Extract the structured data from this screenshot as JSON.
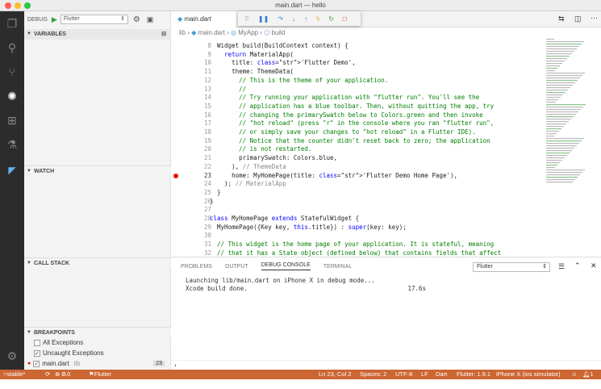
{
  "window": {
    "title": "main.dart — hello"
  },
  "debug": {
    "label": "DEBUG",
    "config": "Flutter"
  },
  "sections": {
    "variables": "VARIABLES",
    "watch": "WATCH",
    "callstack": "CALL STACK",
    "breakpoints": "BREAKPOINTS"
  },
  "breakpoints": [
    {
      "label": "All Exceptions",
      "checked": false
    },
    {
      "label": "Uncaught Exceptions",
      "checked": true
    },
    {
      "label": "main.dart",
      "dir": "lib",
      "line": "23",
      "checked": true
    }
  ],
  "tab": {
    "file": "main.dart"
  },
  "breadcrumb": {
    "dir": "lib",
    "file": "main.dart",
    "cls": "MyApp",
    "method": "build"
  },
  "lines": [
    {
      "n": "8",
      "t": "  Widget build(BuildContext context) {"
    },
    {
      "n": "9",
      "t": "    return MaterialApp("
    },
    {
      "n": "10",
      "t": "      title: 'Flutter Demo',"
    },
    {
      "n": "11",
      "t": "      theme: ThemeData("
    },
    {
      "n": "12",
      "t": "        // This is the theme of your application."
    },
    {
      "n": "13",
      "t": "        //"
    },
    {
      "n": "14",
      "t": "        // Try running your application with \"flutter run\". You'll see the"
    },
    {
      "n": "15",
      "t": "        // application has a blue toolbar. Then, without quitting the app, try"
    },
    {
      "n": "16",
      "t": "        // changing the primarySwatch below to Colors.green and then invoke"
    },
    {
      "n": "17",
      "t": "        // \"hot reload\" (press \"r\" in the console where you ran \"flutter run\","
    },
    {
      "n": "18",
      "t": "        // or simply save your changes to \"hot reload\" in a Flutter IDE)."
    },
    {
      "n": "19",
      "t": "        // Notice that the counter didn't reset back to zero; the application"
    },
    {
      "n": "20",
      "t": "        // is not restarted."
    },
    {
      "n": "21",
      "t": "        primarySwatch: Colors.blue,"
    },
    {
      "n": "22",
      "t": "      ), // ThemeData"
    },
    {
      "n": "23",
      "t": "      home: MyHomePage(title: 'Flutter Demo Home Page'),"
    },
    {
      "n": "24",
      "t": "    ); // MaterialApp"
    },
    {
      "n": "25",
      "t": "  }"
    },
    {
      "n": "26",
      "t": "}"
    },
    {
      "n": "27",
      "t": ""
    },
    {
      "n": "28",
      "t": "class MyHomePage extends StatefulWidget {"
    },
    {
      "n": "29",
      "t": "  MyHomePage({Key key, this.title}) : super(key: key);"
    },
    {
      "n": "30",
      "t": ""
    },
    {
      "n": "31",
      "t": "  // This widget is the home page of your application. It is stateful, meaning"
    },
    {
      "n": "32",
      "t": "  // that it has a State object (defined below) that contains fields that affect"
    }
  ],
  "panel": {
    "tabs": [
      "PROBLEMS",
      "OUTPUT",
      "DEBUG CONSOLE",
      "TERMINAL"
    ],
    "active": "DEBUG CONSOLE",
    "select": "Flutter",
    "output": [
      "Launching lib/main.dart on iPhone X in debug mode...",
      "Xcode build done.                                            17.6s"
    ]
  },
  "status": {
    "branch": "stable*",
    "errors": "0",
    "warnings": "0",
    "run": "Flutter (hello)",
    "pos": "Ln 23, Col 2",
    "spaces": "Spaces: 2",
    "enc": "UTF-8",
    "eol": "LF",
    "lang": "Dart",
    "sdk": "Flutter: 1.9.1",
    "device": "iPhone X (ios simulator)",
    "bell": "1"
  },
  "colors": {
    "statusbar": "#cc6633",
    "activity": "#2c2c2c",
    "arrow": "#e8633b"
  }
}
